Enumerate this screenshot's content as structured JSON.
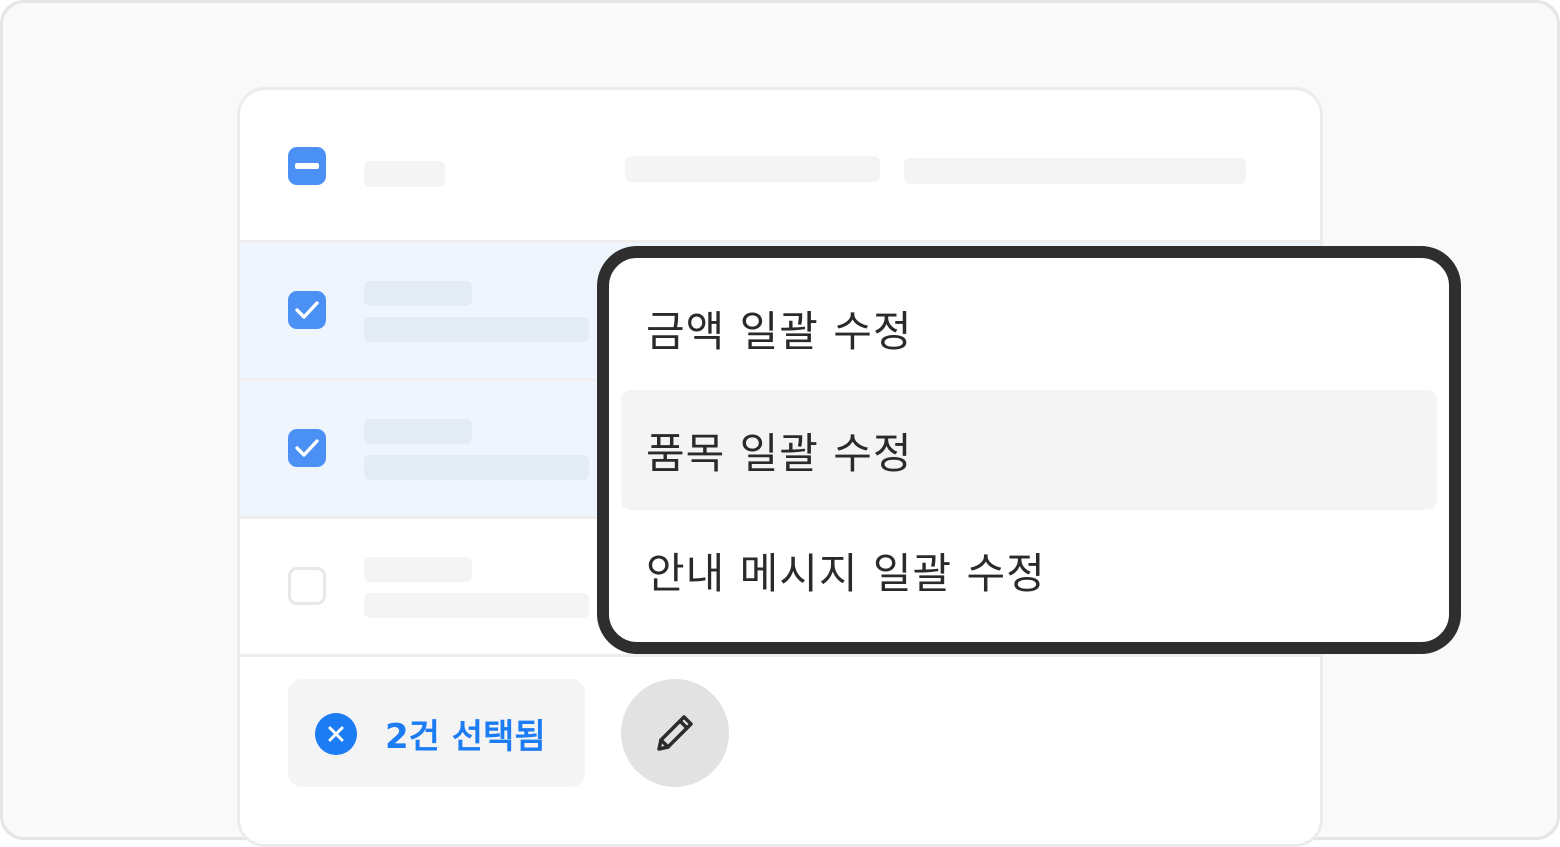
{
  "menu": {
    "items": [
      {
        "label": "금액 일괄 수정",
        "highlighted": false
      },
      {
        "label": "품목 일괄 수정",
        "highlighted": true
      },
      {
        "label": "안내 메시지 일괄 수정",
        "highlighted": false
      }
    ]
  },
  "selection": {
    "text": "2건 선택됨",
    "count": 2
  },
  "table": {
    "header_checkbox_state": "indeterminate",
    "rows": [
      {
        "checked": true
      },
      {
        "checked": true
      },
      {
        "checked": false
      }
    ]
  },
  "colors": {
    "accent": "#1b7cf3",
    "checkbox_blue": "#4a90f5",
    "selected_row": "#eef5fd",
    "dropdown_border": "#2e2e2e",
    "menu_hover": "#f4f4f4",
    "edit_button": "#e2e2e2"
  },
  "icons": {
    "header_checkbox": "minus-icon",
    "row_checkbox": "check-icon",
    "clear_selection": "close-icon",
    "edit": "pencil-icon"
  }
}
